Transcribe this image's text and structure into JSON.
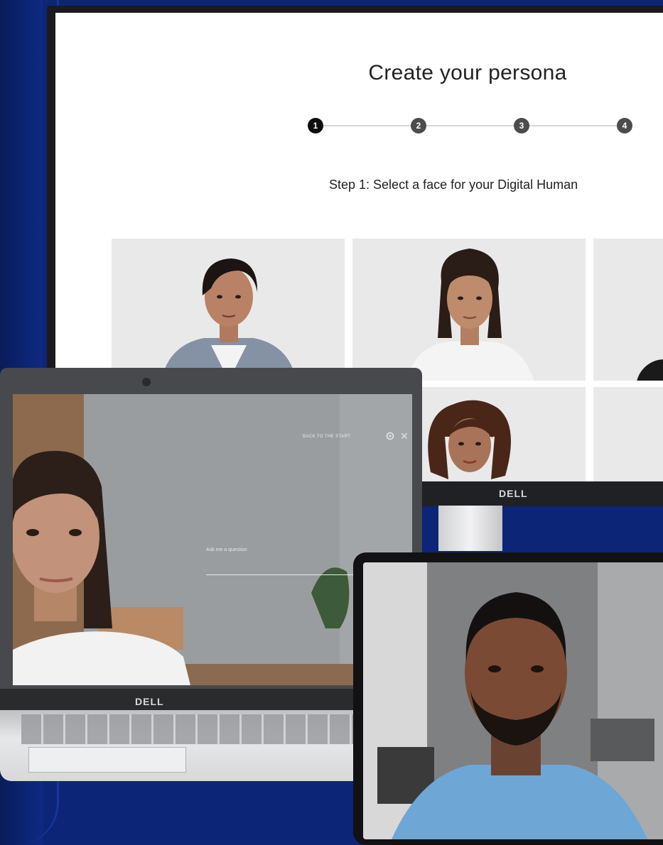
{
  "persona_page": {
    "title": "Create your persona",
    "steps": [
      "1",
      "2",
      "3",
      "4"
    ],
    "active_step": 1,
    "step_instruction": "Step 1: Select a face for your Digital Human"
  },
  "brand": {
    "monitor_logo": "DELL",
    "laptop_logo": "DELL"
  },
  "laptop_app": {
    "back_link": "BACK TO THE START",
    "question_placeholder": "Ask me a question"
  },
  "colors": {
    "background": "#0c2577",
    "active_step": "#0d0d0d",
    "inactive_step": "#4c4c4e",
    "card_bg": "#e9e9ea"
  },
  "icons": [
    "gear-icon",
    "close-icon",
    "mic-icon",
    "back-arrow-icon"
  ]
}
